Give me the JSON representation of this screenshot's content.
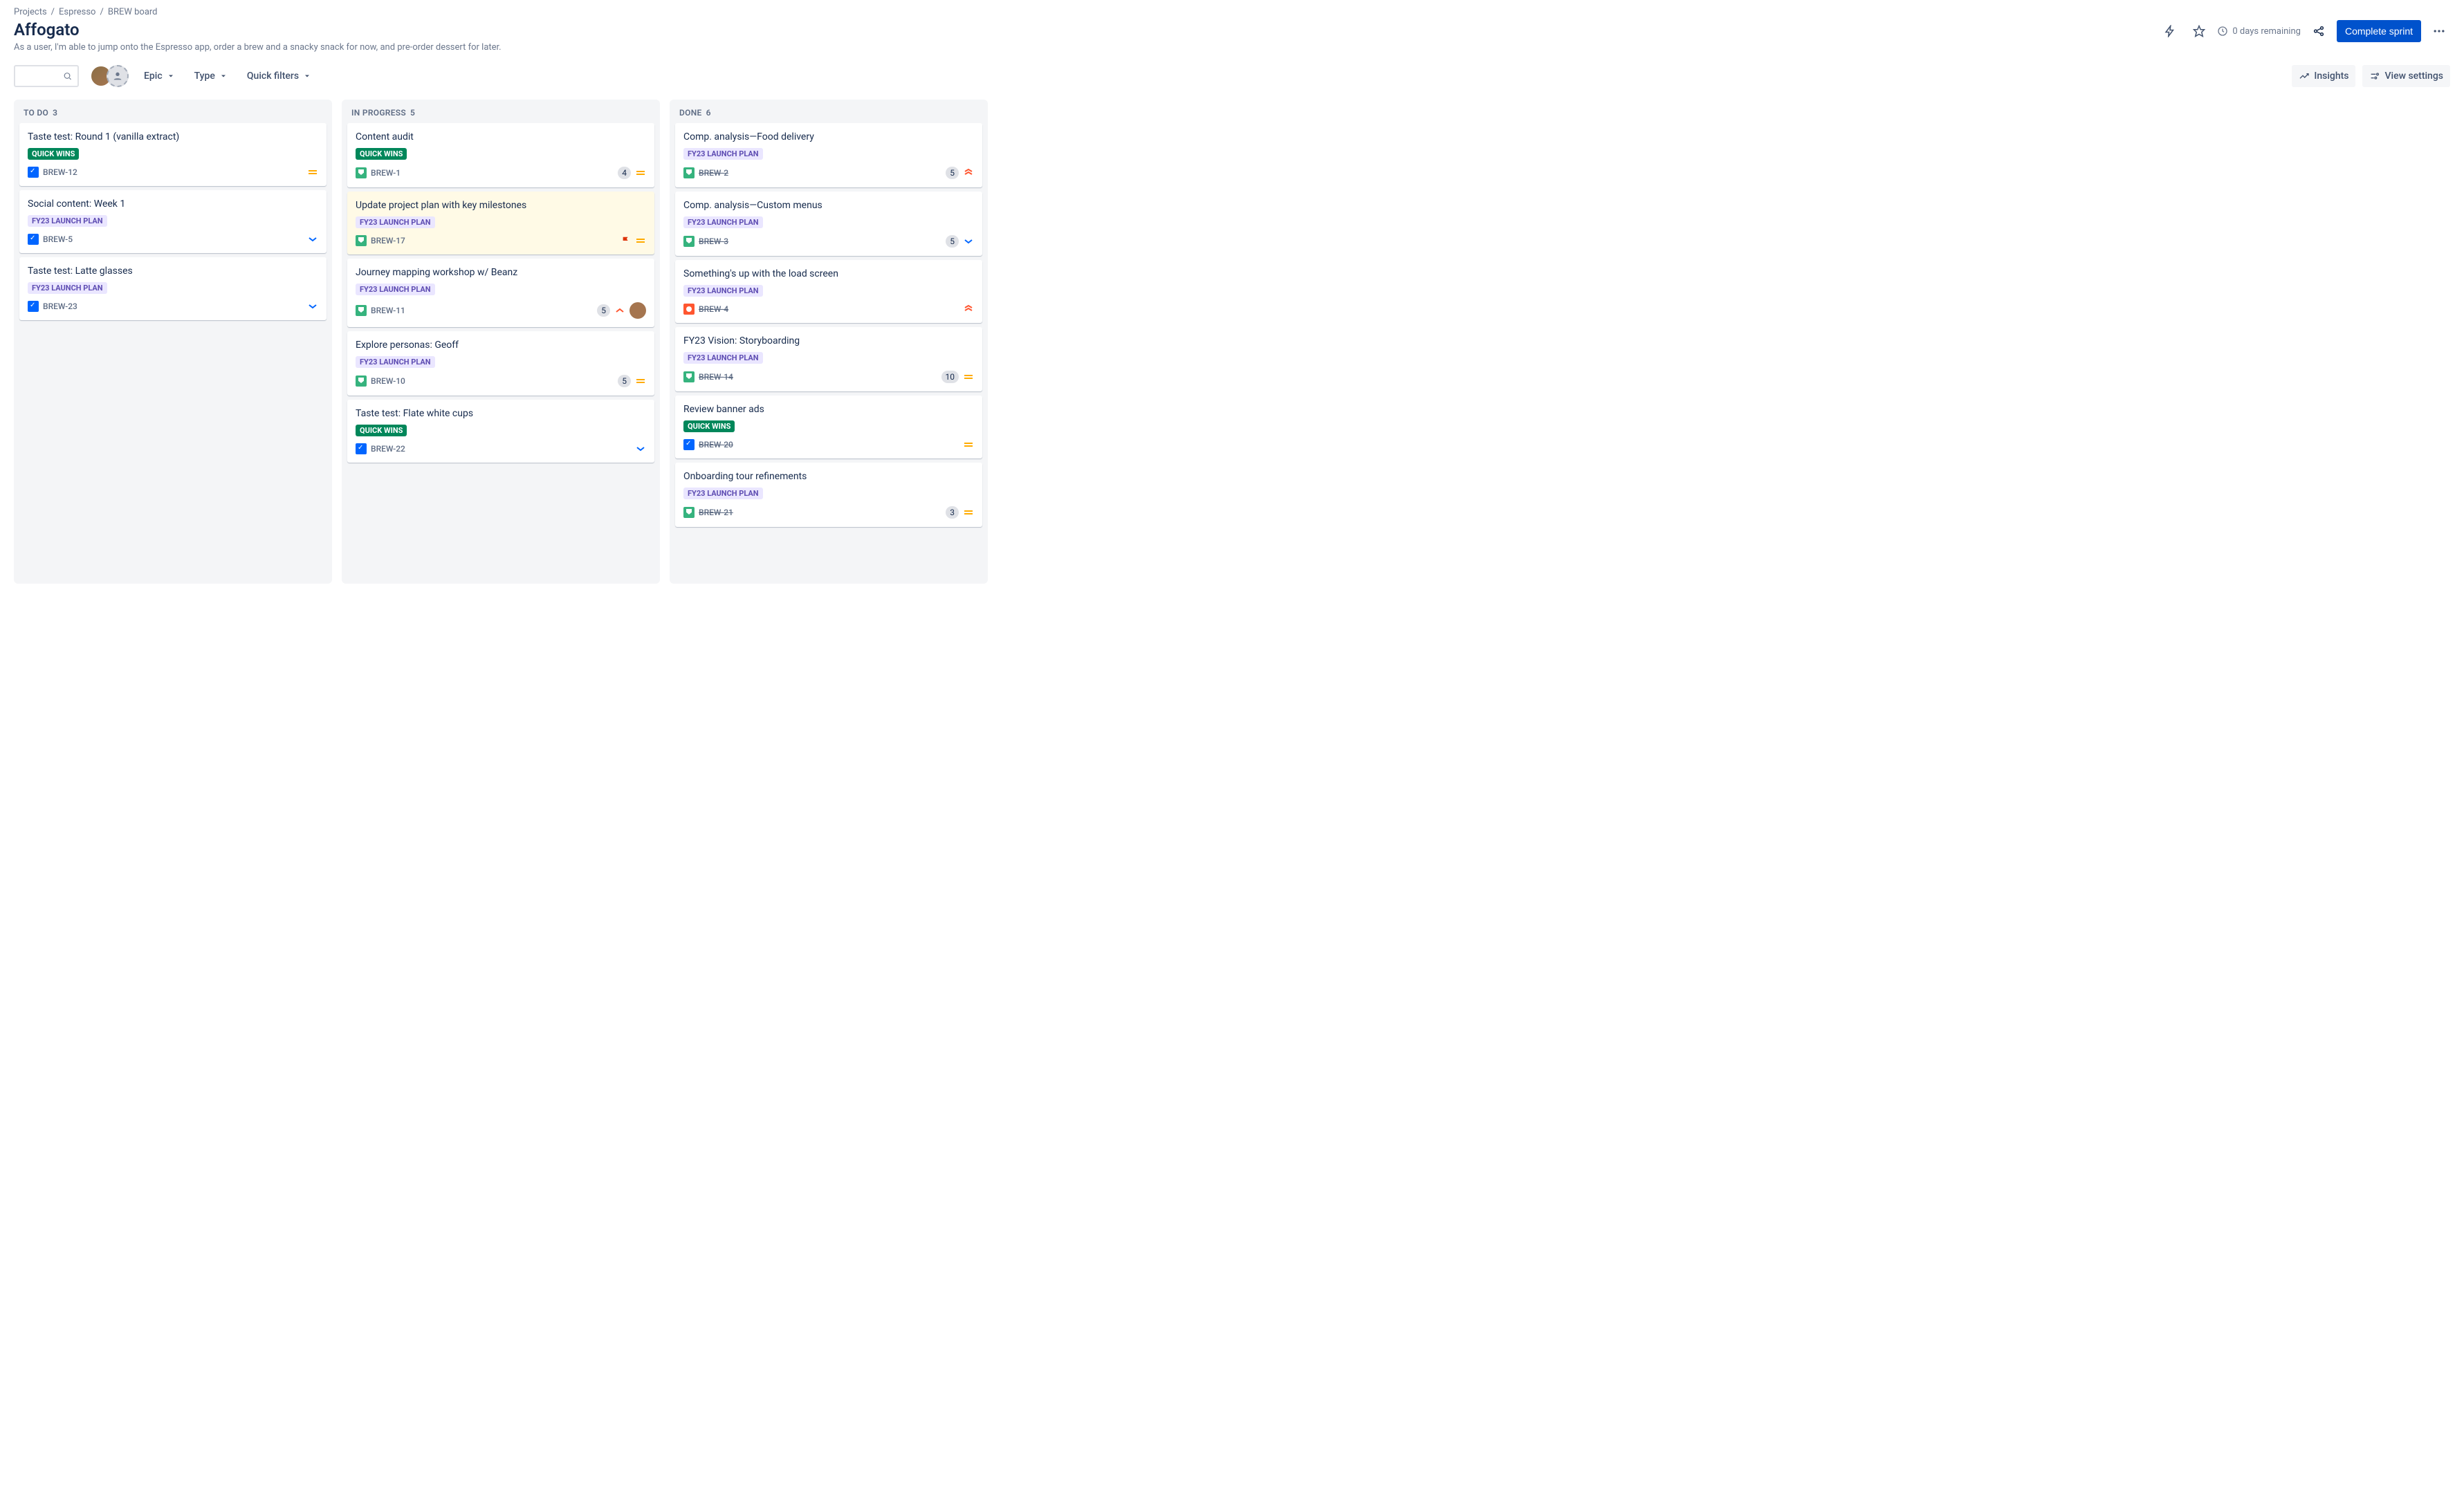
{
  "breadcrumb": {
    "items": [
      "Projects",
      "Espresso",
      "BREW board"
    ]
  },
  "header": {
    "title": "Affogato",
    "description": "As a user, I'm able to jump onto the Espresso app, order a brew and a snacky snack for now, and pre-order dessert for later.",
    "time_remaining": "0 days remaining",
    "complete_sprint": "Complete sprint"
  },
  "toolbar": {
    "epic": "Epic",
    "type": "Type",
    "quick_filters": "Quick filters",
    "insights": "Insights",
    "view_settings": "View settings",
    "search_placeholder": ""
  },
  "columns": [
    {
      "title": "TO DO",
      "count": 3,
      "cards": [
        {
          "title": "Taste test: Round 1 (vanilla extract)",
          "tag_text": "QUICK WINS",
          "tag_style": "teal",
          "issue_type": "task",
          "issue_key": "BREW-12",
          "priority": "medium"
        },
        {
          "title": "Social content: Week 1",
          "tag_text": "FY23 LAUNCH PLAN",
          "tag_style": "lavender",
          "issue_type": "task",
          "issue_key": "BREW-5",
          "priority": "low"
        },
        {
          "title": "Taste test: Latte glasses",
          "tag_text": "FY23 LAUNCH PLAN",
          "tag_style": "lavender",
          "issue_type": "task",
          "issue_key": "BREW-23",
          "priority": "low"
        }
      ]
    },
    {
      "title": "IN PROGRESS",
      "count": 5,
      "cards": [
        {
          "title": "Content audit",
          "tag_text": "QUICK WINS",
          "tag_style": "teal",
          "issue_type": "story",
          "issue_key": "BREW-1",
          "count": "4",
          "priority": "medium"
        },
        {
          "title": "Update project plan with key milestones",
          "tag_text": "FY23 LAUNCH PLAN",
          "tag_style": "lavender",
          "issue_type": "story",
          "issue_key": "BREW-17",
          "flagged": true,
          "priority": "medium",
          "highlight": true
        },
        {
          "title": "Journey mapping workshop w/ Beanz",
          "tag_text": "FY23 LAUNCH PLAN",
          "tag_style": "lavender",
          "issue_type": "story",
          "issue_key": "BREW-11",
          "count": "5",
          "priority": "high",
          "assignee_color": "#A5754F"
        },
        {
          "title": "Explore personas: Geoff",
          "tag_text": "FY23 LAUNCH PLAN",
          "tag_style": "lavender",
          "issue_type": "story",
          "issue_key": "BREW-10",
          "count": "5",
          "priority": "medium"
        },
        {
          "title": "Taste test: Flate white cups",
          "tag_text": "QUICK WINS",
          "tag_style": "teal",
          "issue_type": "task",
          "issue_key": "BREW-22",
          "priority": "low"
        }
      ]
    },
    {
      "title": "DONE",
      "count": 6,
      "cards": [
        {
          "title": "Comp. analysis—Food delivery",
          "tag_text": "FY23 LAUNCH PLAN",
          "tag_style": "lavender",
          "issue_type": "story",
          "issue_key": "BREW-2",
          "done": true,
          "count": "5",
          "priority": "highest"
        },
        {
          "title": "Comp. analysis—Custom menus",
          "tag_text": "FY23 LAUNCH PLAN",
          "tag_style": "lavender",
          "issue_type": "story",
          "issue_key": "BREW-3",
          "done": true,
          "count": "5",
          "priority": "low"
        },
        {
          "title": "Something's up with the load screen",
          "tag_text": "FY23 LAUNCH PLAN",
          "tag_style": "lavender",
          "issue_type": "bug",
          "issue_key": "BREW-4",
          "done": true,
          "priority": "highest"
        },
        {
          "title": "FY23 Vision: Storyboarding",
          "tag_text": "FY23 LAUNCH PLAN",
          "tag_style": "lavender",
          "issue_type": "story",
          "issue_key": "BREW-14",
          "done": true,
          "count": "10",
          "priority": "medium"
        },
        {
          "title": "Review banner ads",
          "tag_text": "QUICK WINS",
          "tag_style": "teal",
          "issue_type": "task",
          "issue_key": "BREW-20",
          "done": true,
          "priority": "medium"
        },
        {
          "title": "Onboarding tour refinements",
          "tag_text": "FY23 LAUNCH PLAN",
          "tag_style": "lavender",
          "issue_type": "story",
          "issue_key": "BREW-21",
          "done": true,
          "count": "3",
          "priority": "medium"
        }
      ]
    }
  ]
}
